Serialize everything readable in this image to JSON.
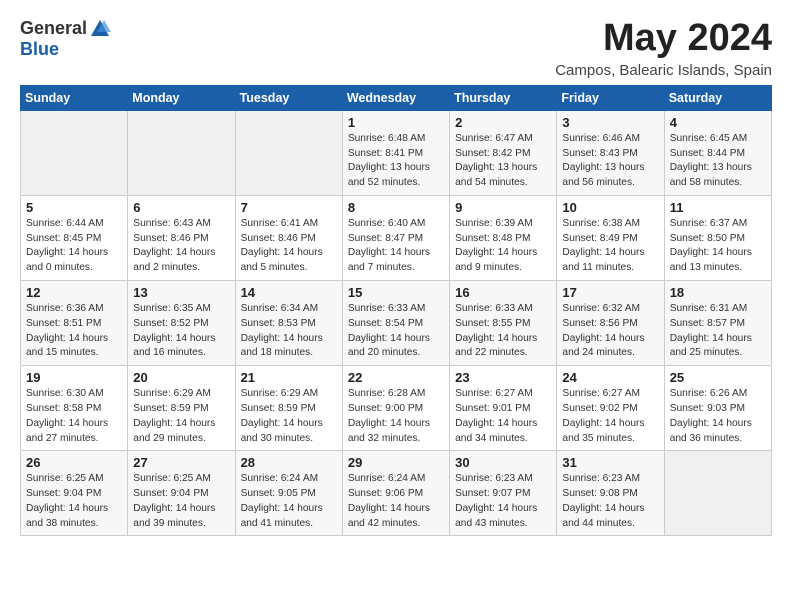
{
  "header": {
    "logo_general": "General",
    "logo_blue": "Blue",
    "title": "May 2024",
    "location": "Campos, Balearic Islands, Spain"
  },
  "weekdays": [
    "Sunday",
    "Monday",
    "Tuesday",
    "Wednesday",
    "Thursday",
    "Friday",
    "Saturday"
  ],
  "weeks": [
    [
      {
        "day": "",
        "info": ""
      },
      {
        "day": "",
        "info": ""
      },
      {
        "day": "",
        "info": ""
      },
      {
        "day": "1",
        "info": "Sunrise: 6:48 AM\nSunset: 8:41 PM\nDaylight: 13 hours and 52 minutes."
      },
      {
        "day": "2",
        "info": "Sunrise: 6:47 AM\nSunset: 8:42 PM\nDaylight: 13 hours and 54 minutes."
      },
      {
        "day": "3",
        "info": "Sunrise: 6:46 AM\nSunset: 8:43 PM\nDaylight: 13 hours and 56 minutes."
      },
      {
        "day": "4",
        "info": "Sunrise: 6:45 AM\nSunset: 8:44 PM\nDaylight: 13 hours and 58 minutes."
      }
    ],
    [
      {
        "day": "5",
        "info": "Sunrise: 6:44 AM\nSunset: 8:45 PM\nDaylight: 14 hours and 0 minutes."
      },
      {
        "day": "6",
        "info": "Sunrise: 6:43 AM\nSunset: 8:46 PM\nDaylight: 14 hours and 2 minutes."
      },
      {
        "day": "7",
        "info": "Sunrise: 6:41 AM\nSunset: 8:46 PM\nDaylight: 14 hours and 5 minutes."
      },
      {
        "day": "8",
        "info": "Sunrise: 6:40 AM\nSunset: 8:47 PM\nDaylight: 14 hours and 7 minutes."
      },
      {
        "day": "9",
        "info": "Sunrise: 6:39 AM\nSunset: 8:48 PM\nDaylight: 14 hours and 9 minutes."
      },
      {
        "day": "10",
        "info": "Sunrise: 6:38 AM\nSunset: 8:49 PM\nDaylight: 14 hours and 11 minutes."
      },
      {
        "day": "11",
        "info": "Sunrise: 6:37 AM\nSunset: 8:50 PM\nDaylight: 14 hours and 13 minutes."
      }
    ],
    [
      {
        "day": "12",
        "info": "Sunrise: 6:36 AM\nSunset: 8:51 PM\nDaylight: 14 hours and 15 minutes."
      },
      {
        "day": "13",
        "info": "Sunrise: 6:35 AM\nSunset: 8:52 PM\nDaylight: 14 hours and 16 minutes."
      },
      {
        "day": "14",
        "info": "Sunrise: 6:34 AM\nSunset: 8:53 PM\nDaylight: 14 hours and 18 minutes."
      },
      {
        "day": "15",
        "info": "Sunrise: 6:33 AM\nSunset: 8:54 PM\nDaylight: 14 hours and 20 minutes."
      },
      {
        "day": "16",
        "info": "Sunrise: 6:33 AM\nSunset: 8:55 PM\nDaylight: 14 hours and 22 minutes."
      },
      {
        "day": "17",
        "info": "Sunrise: 6:32 AM\nSunset: 8:56 PM\nDaylight: 14 hours and 24 minutes."
      },
      {
        "day": "18",
        "info": "Sunrise: 6:31 AM\nSunset: 8:57 PM\nDaylight: 14 hours and 25 minutes."
      }
    ],
    [
      {
        "day": "19",
        "info": "Sunrise: 6:30 AM\nSunset: 8:58 PM\nDaylight: 14 hours and 27 minutes."
      },
      {
        "day": "20",
        "info": "Sunrise: 6:29 AM\nSunset: 8:59 PM\nDaylight: 14 hours and 29 minutes."
      },
      {
        "day": "21",
        "info": "Sunrise: 6:29 AM\nSunset: 8:59 PM\nDaylight: 14 hours and 30 minutes."
      },
      {
        "day": "22",
        "info": "Sunrise: 6:28 AM\nSunset: 9:00 PM\nDaylight: 14 hours and 32 minutes."
      },
      {
        "day": "23",
        "info": "Sunrise: 6:27 AM\nSunset: 9:01 PM\nDaylight: 14 hours and 34 minutes."
      },
      {
        "day": "24",
        "info": "Sunrise: 6:27 AM\nSunset: 9:02 PM\nDaylight: 14 hours and 35 minutes."
      },
      {
        "day": "25",
        "info": "Sunrise: 6:26 AM\nSunset: 9:03 PM\nDaylight: 14 hours and 36 minutes."
      }
    ],
    [
      {
        "day": "26",
        "info": "Sunrise: 6:25 AM\nSunset: 9:04 PM\nDaylight: 14 hours and 38 minutes."
      },
      {
        "day": "27",
        "info": "Sunrise: 6:25 AM\nSunset: 9:04 PM\nDaylight: 14 hours and 39 minutes."
      },
      {
        "day": "28",
        "info": "Sunrise: 6:24 AM\nSunset: 9:05 PM\nDaylight: 14 hours and 41 minutes."
      },
      {
        "day": "29",
        "info": "Sunrise: 6:24 AM\nSunset: 9:06 PM\nDaylight: 14 hours and 42 minutes."
      },
      {
        "day": "30",
        "info": "Sunrise: 6:23 AM\nSunset: 9:07 PM\nDaylight: 14 hours and 43 minutes."
      },
      {
        "day": "31",
        "info": "Sunrise: 6:23 AM\nSunset: 9:08 PM\nDaylight: 14 hours and 44 minutes."
      },
      {
        "day": "",
        "info": ""
      }
    ]
  ]
}
